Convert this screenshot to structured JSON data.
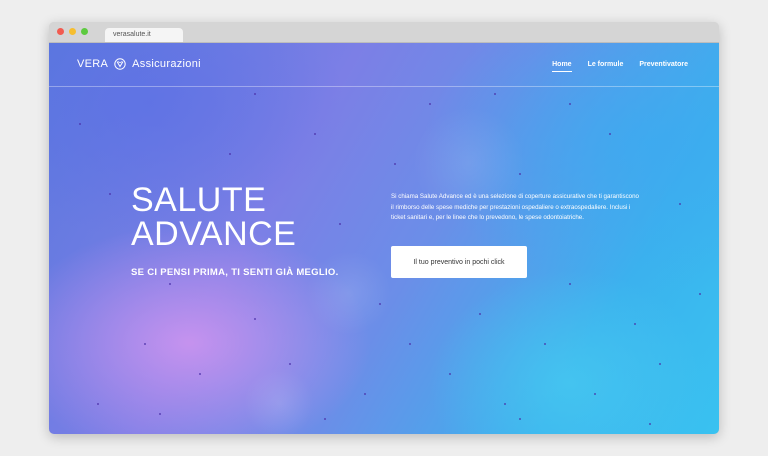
{
  "browser": {
    "tab_url": "verasalute.it"
  },
  "header": {
    "logo_left": "VERA",
    "logo_right": "Assicurazioni",
    "nav": [
      {
        "label": "Home",
        "active": true
      },
      {
        "label": "Le formule",
        "active": false
      },
      {
        "label": "Preventivatore",
        "active": false
      }
    ]
  },
  "hero": {
    "title_line1": "SALUTE",
    "title_line2": "ADVANCE",
    "tagline": "SE CI PENSI PRIMA, TI SENTI GIÀ MEGLIO.",
    "description": "Si chiama Salute Advance ed è una selezione di coperture assicurative che ti garantiscono il rimborso delle spese mediche per prestazioni ospedaliere o extraospedaliere. Inclusi i ticket sanitari e, per le linee che lo prevedono, le spese odontoiatriche.",
    "cta_label": "Il tuo preventivo in pochi click"
  }
}
